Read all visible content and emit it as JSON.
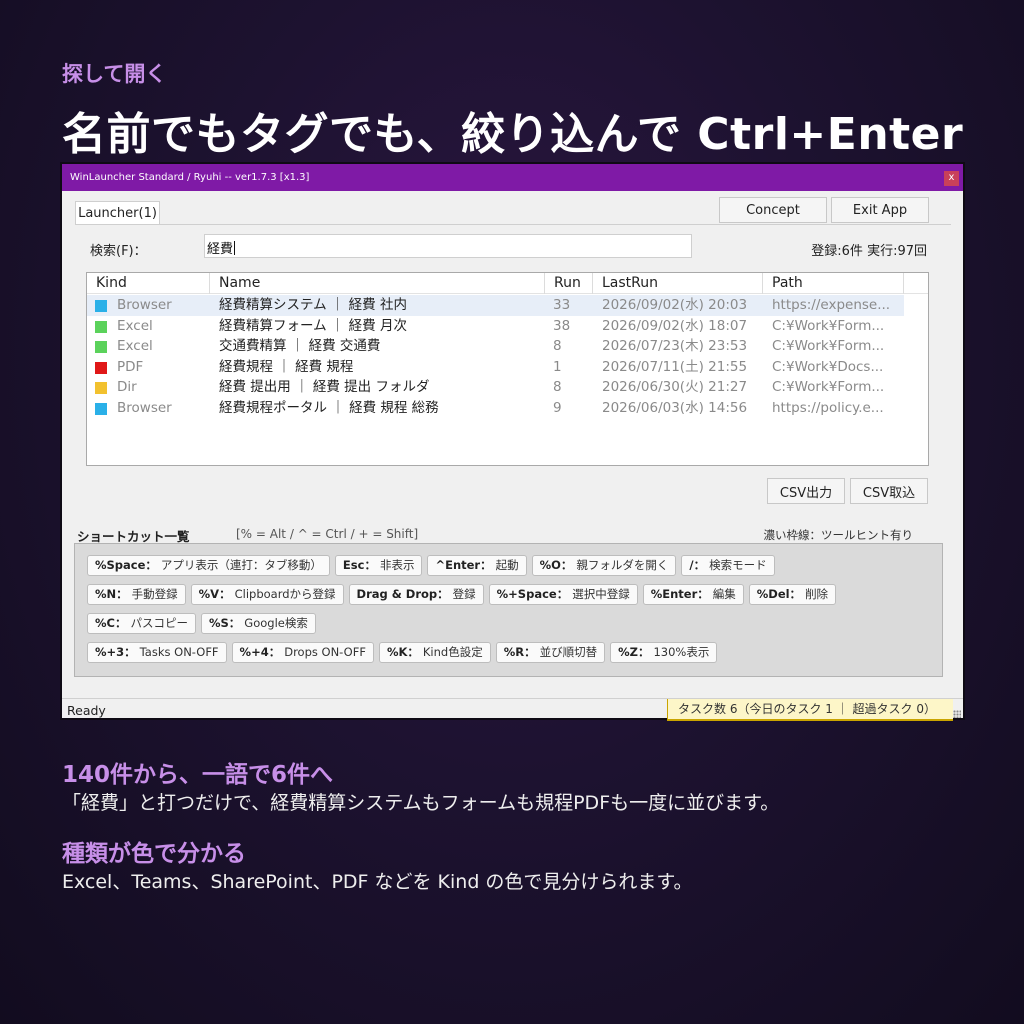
{
  "promo": {
    "eyebrow": "探して開く",
    "headline": "名前でもタグでも、絞り込んで Ctrl+Enter",
    "features": [
      {
        "title": "140件から、一語で6件へ",
        "text": "「経費」と打つだけで、経費精算システムもフォームも規程PDFも一度に並びます。"
      },
      {
        "title": "種類が色で分かる",
        "text": "Excel、Teams、SharePoint、PDF などを Kind の色で見分けられます。"
      }
    ]
  },
  "window": {
    "title": "WinLauncher Standard / Ryuhi -- ver1.7.3 [x1.3]",
    "close": "x",
    "tab": "Launcher(1)",
    "buttons": {
      "concept": "Concept",
      "exit": "Exit App",
      "csv_export": "CSV出力",
      "csv_import": "CSV取込"
    },
    "search": {
      "label": "検索(F)：",
      "value": "経費"
    },
    "stats": "登録:6件 実行:97回",
    "table": {
      "columns": [
        "Kind",
        "Name",
        "Run",
        "LastRun",
        "Path"
      ],
      "rows": [
        {
          "kind": "Browser",
          "color": "#2ab0e8",
          "name": "経費精算システム ｜ 経費 社内",
          "run": "33",
          "last": "2026/09/02(水) 20:03",
          "path": "https://expense...",
          "selected": true
        },
        {
          "kind": "Excel",
          "color": "#5bd25b",
          "name": "経費精算フォーム ｜ 経費 月次",
          "run": "38",
          "last": "2026/09/02(水) 18:07",
          "path": "C:¥Work¥Form..."
        },
        {
          "kind": "Excel",
          "color": "#5bd25b",
          "name": "交通費精算 ｜ 経費 交通費",
          "run": "8",
          "last": "2026/07/23(木) 23:53",
          "path": "C:¥Work¥Form..."
        },
        {
          "kind": "PDF",
          "color": "#e01818",
          "name": "経費規程 ｜ 経費 規程",
          "run": "1",
          "last": "2026/07/11(土) 21:55",
          "path": "C:¥Work¥Docs..."
        },
        {
          "kind": "Dir",
          "color": "#f2c12e",
          "name": "経費 提出用 ｜ 経費 提出 フォルダ",
          "run": "8",
          "last": "2026/06/30(火) 21:27",
          "path": "C:¥Work¥Form..."
        },
        {
          "kind": "Browser",
          "color": "#2ab0e8",
          "name": "経費規程ポータル ｜ 経費 規程 総務",
          "run": "9",
          "last": "2026/06/03(水) 14:56",
          "path": "https://policy.e..."
        }
      ]
    },
    "shortcuts": {
      "title": "ショートカット一覧",
      "legend": "[% = Alt / ^ = Ctrl / + = Shift]",
      "note": "濃い枠線：ツールヒント有り",
      "lines": [
        [
          {
            "k": "%Space：",
            "v": "アプリ表示（連打：タブ移動）"
          },
          {
            "k": "Esc：",
            "v": "非表示"
          },
          {
            "k": "^Enter：",
            "v": "起動"
          },
          {
            "k": "%O：",
            "v": "親フォルダを開く"
          },
          {
            "k": "/：",
            "v": "検索モード"
          }
        ],
        [
          {
            "k": "%N：",
            "v": "手動登録"
          },
          {
            "k": "%V：",
            "v": "Clipboardから登録"
          },
          {
            "k": "Drag & Drop：",
            "v": "登録"
          },
          {
            "k": "%+Space：",
            "v": "選択中登録"
          },
          {
            "k": "%Enter：",
            "v": "編集"
          },
          {
            "k": "%Del：",
            "v": "削除"
          }
        ],
        [
          {
            "k": "%C：",
            "v": "パスコピー"
          },
          {
            "k": "%S：",
            "v": "Google検索"
          }
        ],
        [
          {
            "k": "%+3：",
            "v": "Tasks ON-OFF"
          },
          {
            "k": "%+4：",
            "v": "Drops ON-OFF"
          },
          {
            "k": "%K：",
            "v": "Kind色設定"
          },
          {
            "k": "%R：",
            "v": "並び順切替"
          },
          {
            "k": "%Z：",
            "v": "130%表示"
          }
        ]
      ]
    },
    "status": {
      "ready": "Ready",
      "tasks": "タスク数 6（今日のタスク 1 ｜ 超過タスク 0）"
    }
  }
}
